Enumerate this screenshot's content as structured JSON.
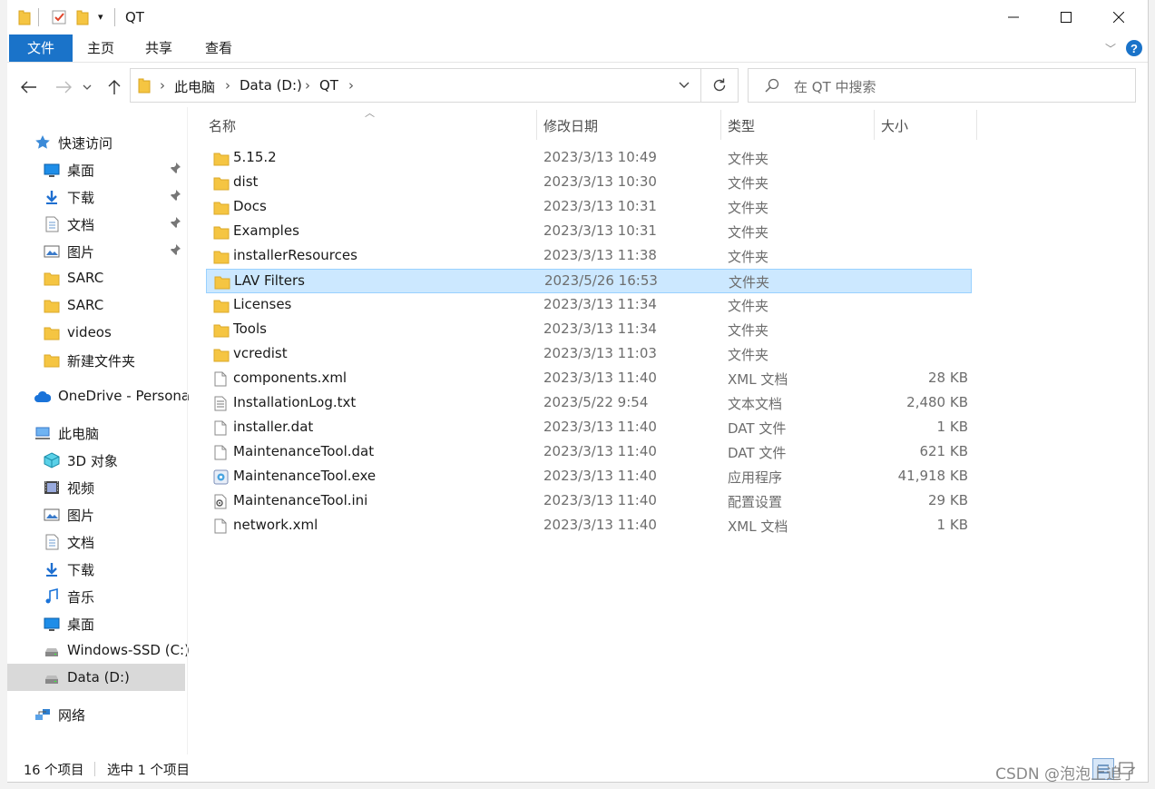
{
  "window": {
    "title": "QT"
  },
  "ribbon": {
    "tabs": [
      {
        "label": "文件"
      },
      {
        "label": "主页"
      },
      {
        "label": "共享"
      },
      {
        "label": "查看"
      }
    ]
  },
  "address": {
    "crumbs": [
      "此电脑",
      "Data (D:)",
      "QT"
    ],
    "search_placeholder": "在 QT 中搜索"
  },
  "nav": {
    "items": [
      {
        "label": "快速访问",
        "icon": "star-icon"
      },
      {
        "label": "桌面",
        "icon": "desktop-icon",
        "pinned": true
      },
      {
        "label": "下载",
        "icon": "download-icon",
        "pinned": true
      },
      {
        "label": "文档",
        "icon": "document-icon",
        "pinned": true
      },
      {
        "label": "图片",
        "icon": "picture-icon",
        "pinned": true
      },
      {
        "label": "SARC",
        "icon": "folder-icon"
      },
      {
        "label": "SARC",
        "icon": "folder-icon"
      },
      {
        "label": "videos",
        "icon": "folder-icon"
      },
      {
        "label": "新建文件夹",
        "icon": "folder-icon"
      },
      {
        "label": "OneDrive - Persona",
        "icon": "cloud-icon"
      },
      {
        "label": "此电脑",
        "icon": "computer-icon"
      },
      {
        "label": "3D 对象",
        "icon": "cube-icon"
      },
      {
        "label": "视频",
        "icon": "video-icon"
      },
      {
        "label": "图片",
        "icon": "picture-icon"
      },
      {
        "label": "文档",
        "icon": "document-icon"
      },
      {
        "label": "下载",
        "icon": "download-icon"
      },
      {
        "label": "音乐",
        "icon": "music-icon"
      },
      {
        "label": "桌面",
        "icon": "desktop-icon"
      },
      {
        "label": "Windows-SSD (C:)",
        "icon": "drive-icon"
      },
      {
        "label": "Data (D:)",
        "icon": "drive-icon",
        "selected": true
      },
      {
        "label": "网络",
        "icon": "network-icon"
      }
    ]
  },
  "list": {
    "columns": {
      "name": "名称",
      "date": "修改日期",
      "type": "类型",
      "size": "大小"
    },
    "files": [
      {
        "name": "5.15.2",
        "date": "2023/3/13 10:49",
        "type": "文件夹",
        "size": "",
        "icon": "folder-icon"
      },
      {
        "name": "dist",
        "date": "2023/3/13 10:30",
        "type": "文件夹",
        "size": "",
        "icon": "folder-icon"
      },
      {
        "name": "Docs",
        "date": "2023/3/13 10:31",
        "type": "文件夹",
        "size": "",
        "icon": "folder-icon"
      },
      {
        "name": "Examples",
        "date": "2023/3/13 10:31",
        "type": "文件夹",
        "size": "",
        "icon": "folder-icon"
      },
      {
        "name": "installerResources",
        "date": "2023/3/13 11:38",
        "type": "文件夹",
        "size": "",
        "icon": "folder-icon"
      },
      {
        "name": "LAV Filters",
        "date": "2023/5/26 16:53",
        "type": "文件夹",
        "size": "",
        "icon": "folder-icon",
        "selected": true
      },
      {
        "name": "Licenses",
        "date": "2023/3/13 11:34",
        "type": "文件夹",
        "size": "",
        "icon": "folder-icon"
      },
      {
        "name": "Tools",
        "date": "2023/3/13 11:34",
        "type": "文件夹",
        "size": "",
        "icon": "folder-icon"
      },
      {
        "name": "vcredist",
        "date": "2023/3/13 11:03",
        "type": "文件夹",
        "size": "",
        "icon": "folder-icon"
      },
      {
        "name": "components.xml",
        "date": "2023/3/13 11:40",
        "type": "XML 文档",
        "size": "28 KB",
        "icon": "file-icon"
      },
      {
        "name": "InstallationLog.txt",
        "date": "2023/5/22 9:54",
        "type": "文本文档",
        "size": "2,480 KB",
        "icon": "text-file-icon"
      },
      {
        "name": "installer.dat",
        "date": "2023/3/13 11:40",
        "type": "DAT 文件",
        "size": "1 KB",
        "icon": "file-icon"
      },
      {
        "name": "MaintenanceTool.dat",
        "date": "2023/3/13 11:40",
        "type": "DAT 文件",
        "size": "621 KB",
        "icon": "file-icon"
      },
      {
        "name": "MaintenanceTool.exe",
        "date": "2023/3/13 11:40",
        "type": "应用程序",
        "size": "41,918 KB",
        "icon": "exe-icon"
      },
      {
        "name": "MaintenanceTool.ini",
        "date": "2023/3/13 11:40",
        "type": "配置设置",
        "size": "29 KB",
        "icon": "settings-file-icon"
      },
      {
        "name": "network.xml",
        "date": "2023/3/13 11:40",
        "type": "XML 文档",
        "size": "1 KB",
        "icon": "file-icon"
      }
    ]
  },
  "status": {
    "count": "16 个项目",
    "selected": "选中 1 个项目"
  },
  "watermark": "CSDN @泡泡上追了",
  "colors": {
    "accent": "#1a73c9",
    "selection": "#cce8ff",
    "folder": "#f5c542"
  }
}
